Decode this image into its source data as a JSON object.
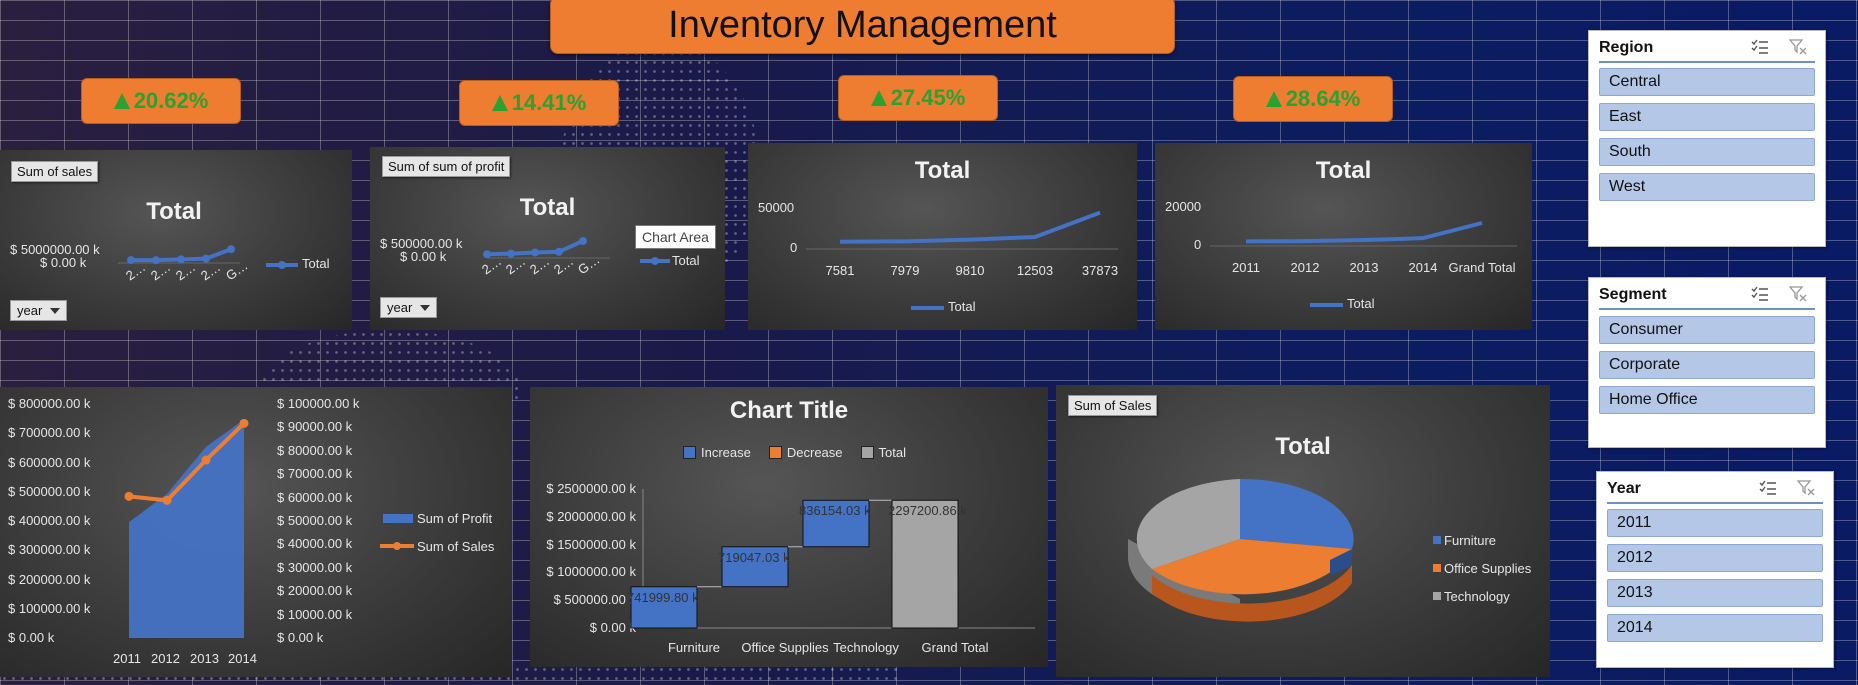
{
  "dashboard": {
    "title": "Inventory Management",
    "kpis": [
      {
        "value": "20.62%",
        "trend": "up"
      },
      {
        "value": "14.41%",
        "trend": "up"
      },
      {
        "value": "27.45%",
        "trend": "up"
      },
      {
        "value": "28.64%",
        "trend": "up"
      }
    ],
    "colors": {
      "accent_orange": "#ee7d31",
      "kpi_green": "#2aa232",
      "series_blue": "#4472c4",
      "slicer_item": "#b4c7e7"
    }
  },
  "charts": {
    "sales_chart": {
      "field_label": "Sum of sales",
      "axis_button": "year",
      "title": "Total",
      "y_ticks": [
        "$ 5000000.00 k",
        "$ 0.00 k"
      ],
      "x_ticks": [
        "2…",
        "2…",
        "2…",
        "2…",
        "G…"
      ],
      "legend": "Total"
    },
    "profit_chart": {
      "field_label": "Sum of sum of profit",
      "axis_button": "year",
      "title": "Total",
      "tooltip": "Chart Area",
      "y_ticks": [
        "$ 500000.00 k",
        "$ 0.00 k"
      ],
      "x_ticks": [
        "2…",
        "2…",
        "2…",
        "2…",
        "G…"
      ],
      "legend": "Total"
    },
    "line_chart_3": {
      "title": "Total",
      "y_ticks": [
        "50000",
        "0"
      ],
      "legend": "Total"
    },
    "line_chart_4": {
      "title": "Total",
      "y_ticks": [
        "20000",
        "0"
      ],
      "legend": "Total"
    },
    "combo_chart": {
      "y_left_ticks": [
        "$ 800000.00 k",
        "$ 700000.00 k",
        "$ 600000.00 k",
        "$ 500000.00 k",
        "$ 400000.00 k",
        "$ 300000.00 k",
        "$ 200000.00 k",
        "$ 100000.00 k",
        "$ 0.00 k"
      ],
      "y_right_ticks": [
        "$ 100000.00 k",
        "$ 90000.00 k",
        "$ 80000.00 k",
        "$ 70000.00 k",
        "$ 60000.00 k",
        "$ 50000.00 k",
        "$ 40000.00 k",
        "$ 30000.00 k",
        "$ 20000.00 k",
        "$ 10000.00 k",
        "$ 0.00 k"
      ],
      "legend": [
        "Sum of Profit",
        "Sum of Sales"
      ]
    },
    "waterfall_chart": {
      "title": "Chart Title",
      "legend": [
        "Increase",
        "Decrease",
        "Total"
      ],
      "y_ticks": [
        "$ 2500000.00 k",
        "$ 2000000.00 k",
        "$ 1500000.00 k",
        "$ 1000000.00 k",
        "$ 500000.00 k",
        "$ 0.00 k"
      ],
      "data_labels": [
        "741999.80 k",
        "719047.03 k",
        "836154.03 k",
        "2297200.86 k"
      ]
    },
    "pie_chart": {
      "field_label": "Sum of Sales",
      "title": "Total",
      "legend": [
        "Furniture",
        "Office Supplies",
        "Technology"
      ]
    }
  },
  "chart_data": [
    {
      "type": "line",
      "title": "Total",
      "categories": [
        "2…",
        "2…",
        "2…",
        "2…",
        "G…"
      ],
      "values": [
        484000,
        470000,
        609000,
        733000,
        2297000
      ],
      "ylabel": "Sum of sales",
      "ylim": [
        0,
        5000000
      ]
    },
    {
      "type": "line",
      "title": "Total",
      "categories": [
        "2…",
        "2…",
        "2…",
        "2…",
        "G…"
      ],
      "values": [
        49000,
        61000,
        81000,
        93000,
        286000
      ],
      "ylabel": "Sum of sum of profit",
      "ylim": [
        0,
        500000
      ]
    },
    {
      "type": "line",
      "title": "Total",
      "categories": [
        "7581",
        "7979",
        "9810",
        "12503",
        "37873"
      ],
      "values": [
        7581,
        7979,
        9810,
        12503,
        37873
      ],
      "ylim": [
        0,
        50000
      ],
      "series": [
        {
          "name": "Total",
          "values": [
            7581,
            7979,
            9810,
            12503,
            37873
          ]
        }
      ]
    },
    {
      "type": "line",
      "title": "Total",
      "categories": [
        "2011",
        "2012",
        "2013",
        "2014",
        "Grand Total"
      ],
      "values": [
        2000,
        2100,
        2600,
        3400,
        10000
      ],
      "ylim": [
        0,
        20000
      ],
      "series": [
        {
          "name": "Total",
          "values": [
            2000,
            2100,
            2600,
            3400,
            10000
          ]
        }
      ]
    },
    {
      "type": "area",
      "categories": [
        "2011",
        "2012",
        "2013",
        "2014"
      ],
      "series": [
        {
          "name": "Sum of Profit",
          "values": [
            49500,
            61600,
            81700,
            93400
          ],
          "axis": "left"
        },
        {
          "name": "Sum of Sales",
          "values": [
            484250,
            470530,
            608470,
            733950
          ],
          "axis": "right"
        }
      ],
      "ylim": [
        0,
        800000
      ],
      "y2lim": [
        0,
        100000
      ]
    },
    {
      "type": "bar",
      "title": "Chart Title",
      "categories": [
        "Furniture",
        "Office Supplies",
        "Technology",
        "Grand Total"
      ],
      "values": [
        741999.8,
        719047.03,
        836154.03,
        2297200.86
      ],
      "ylim": [
        0,
        2500000
      ]
    },
    {
      "type": "pie",
      "title": "Total",
      "categories": [
        "Furniture",
        "Office Supplies",
        "Technology"
      ],
      "values": [
        741999.8,
        719047.03,
        836154.03
      ]
    }
  ],
  "slicers": {
    "region": {
      "title": "Region",
      "items": [
        "Central",
        "East",
        "South",
        "West"
      ]
    },
    "segment": {
      "title": "Segment",
      "items": [
        "Consumer",
        "Corporate",
        "Home Office"
      ]
    },
    "year": {
      "title": "Year",
      "items": [
        "2011",
        "2012",
        "2013",
        "2014"
      ]
    }
  }
}
